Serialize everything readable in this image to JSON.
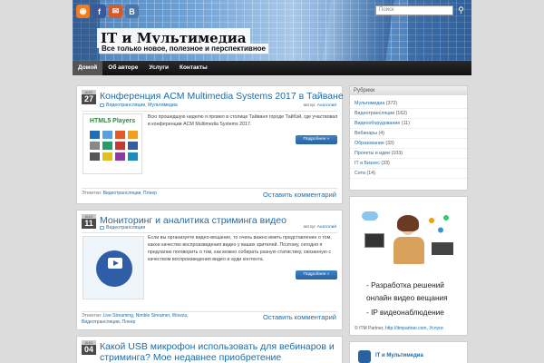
{
  "header": {
    "site_title": "IT и Мультимедиа",
    "site_description": "Все только новое, полезное и перспективное",
    "search_placeholder": "Поиск",
    "social": [
      {
        "name": "rss-icon",
        "glyph": "◉"
      },
      {
        "name": "facebook-icon",
        "glyph": "f"
      },
      {
        "name": "mail-icon",
        "glyph": "✉"
      },
      {
        "name": "vk-icon",
        "glyph": "B"
      }
    ]
  },
  "nav": [
    "Домой",
    "Об авторе",
    "Услуги",
    "Контакты"
  ],
  "posts": [
    {
      "month": "AUG",
      "day": "27",
      "title": "Конференция ACM Multimedia Systems 2017 в Тайване",
      "categories": "Видеотрансляции, Мультимедиа",
      "author_label": "автор:",
      "author": "Анатолий",
      "thumb_title": "HTML5 Players",
      "excerpt": "Всю прошедшую неделю я провел в столице Тайваня городе Тайбэй, где участвовал в конференции ACM Multimedia Systems 2017.",
      "more": "Подробнее »",
      "tags_label": "Этикетки:",
      "tags": "Видеотрансляции, Плеер",
      "comment": "Оставить комментарий"
    },
    {
      "month": "AUG",
      "day": "11",
      "title": "Мониторинг и аналитика стриминга видео",
      "categories": "Видеотрансляции",
      "author_label": "автор:",
      "author": "Анатолий",
      "excerpt": "Если вы организуете видео-вещание, то очень важно иметь представление о том, какое качество воспроизведения видео у ваших зрителей. Поэтому, сегодня я предлагаю поговорить о том, как можно собирать разную статистику, связанную с качеством воспроизведения видео и ауди контента.",
      "more": "Подробнее »",
      "tags_label": "Этикетки:",
      "tags_line1": "Live Streaming, Nimble Streamer, Wowza,",
      "tags_line2": "Видеотрансляции, Плеер",
      "comment": "Оставить комментарий"
    },
    {
      "month": "AUG",
      "day": "04",
      "title_line1": "Какой USB микрофон использовать для вебинаров и",
      "title_line2": "стриминга? Мое недавнее приобретение"
    }
  ],
  "sidebar": {
    "rubrics_title": "Рубрики",
    "rubrics": [
      {
        "label": "Мультимедиа",
        "count": "(372)"
      },
      {
        "label": "Видеотрансляции",
        "count": "(162)"
      },
      {
        "label": "Видеооборудование",
        "count": "(11)"
      },
      {
        "label": "Вебинары",
        "count": "(4)"
      },
      {
        "label": "Образование",
        "count": "(33)"
      },
      {
        "label": "Проекты и идеи",
        "count": "(103)"
      },
      {
        "label": "IT и Бизнес",
        "count": "(33)"
      },
      {
        "label": "Сети",
        "count": "(14)"
      }
    ],
    "promo": {
      "line1": "- Разработка решений",
      "line2": "онлайн видео вещания",
      "line3": "- IP видеонаблюдение",
      "footer_prefix": "© ITM Partner,",
      "footer_link": "http://itmpartner.com,",
      "footer_suffix": "Услуги"
    },
    "bottom_widget_title": "IT и Мультимедиа"
  },
  "colors": {
    "link": "#1f6ba6",
    "button": "#2a62a0",
    "nav_bg": "#111111",
    "date_bg": "#4a4a4a"
  }
}
